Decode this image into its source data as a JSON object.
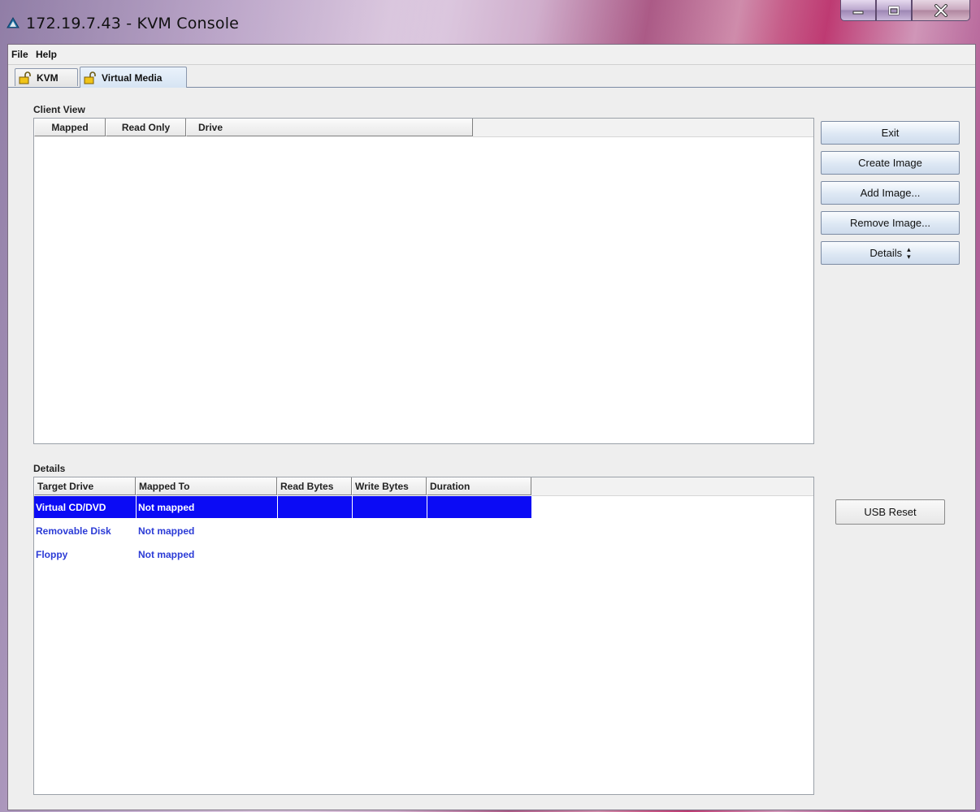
{
  "window": {
    "title": "172.19.7.43 - KVM Console",
    "icon": "triangle-app-icon",
    "caption_buttons": [
      "minimize-icon",
      "maximize-icon",
      "close-icon"
    ]
  },
  "menubar": {
    "items": [
      "File",
      "Help"
    ]
  },
  "tabs": [
    {
      "label": "KVM",
      "icon": "lock-icon",
      "active": false
    },
    {
      "label": "Virtual Media",
      "icon": "lock-icon",
      "active": true
    }
  ],
  "client_view": {
    "label": "Client View",
    "columns": [
      "Mapped",
      "Read Only",
      "Drive"
    ],
    "rows": []
  },
  "actions": {
    "exit": "Exit",
    "create_image": "Create Image",
    "add_image": "Add Image...",
    "remove_image": "Remove Image...",
    "details": "Details",
    "details_icon": "expand-arrows-icon"
  },
  "details": {
    "label": "Details",
    "columns": [
      "Target Drive",
      "Mapped To",
      "Read Bytes",
      "Write Bytes",
      "Duration"
    ],
    "rows": [
      {
        "target": "Virtual CD/DVD",
        "mapped_to": "Not mapped",
        "read": "",
        "write": "",
        "duration": "",
        "selected": true
      },
      {
        "target": "Removable Disk",
        "mapped_to": "Not mapped",
        "read": "",
        "write": "",
        "duration": "",
        "selected": false
      },
      {
        "target": "Floppy",
        "mapped_to": "Not mapped",
        "read": "",
        "write": "",
        "duration": "",
        "selected": false
      }
    ],
    "usb_reset": "USB Reset"
  },
  "colors": {
    "selection": "#0b0bf5",
    "link_text": "#2b3bd6",
    "panel_bg": "#eeeeee"
  }
}
